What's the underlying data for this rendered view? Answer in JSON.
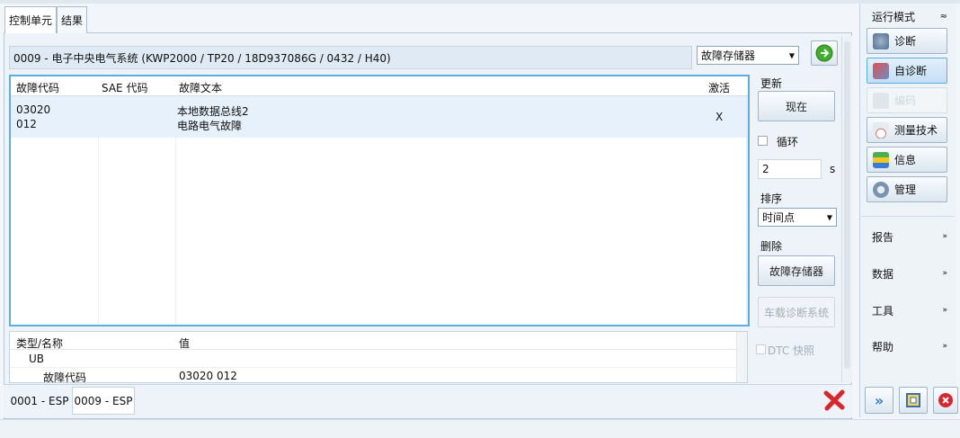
{
  "tabs": {
    "control_units": "控制单元",
    "results": "结果"
  },
  "header": {
    "ecu_title": "0009 - 电子中央电气系统  (KWP2000 / TP20 / 18D937086G / 0432 / H40)"
  },
  "memory_select": {
    "value": "故障存储器"
  },
  "fault_table": {
    "columns": {
      "code": "故障代码",
      "sae": "SAE 代码",
      "text": "故障文本",
      "active": "激活"
    },
    "rows": [
      {
        "code1": "03020",
        "code2": "012",
        "text1": "本地数据总线2",
        "text2": "电路电气故障",
        "active": "X"
      }
    ]
  },
  "details": {
    "col_type": "类型/名称",
    "col_value": "值",
    "group": "UB",
    "row_label": "故障代码",
    "row_value": "03020 012"
  },
  "controls": {
    "update_label": "更新",
    "now_button": "现在",
    "loop_label": "循环",
    "interval_value": "2",
    "interval_unit": "s",
    "sort_label": "排序",
    "sort_value": "时间点",
    "delete_label": "删除",
    "delete_memory_button": "故障存储器",
    "obd_button": "车载诊断系统",
    "dtc_snapshot_label": "DTC 快照"
  },
  "bottom_tabs": [
    "0001 - ESP",
    "0009 - ESP"
  ],
  "sidebar": {
    "run_mode": "运行模式",
    "items": [
      {
        "label": "诊断",
        "icon": "stethoscope-icon"
      },
      {
        "label": "自诊断",
        "icon": "car-diagnosis-icon"
      },
      {
        "label": "编码",
        "icon": "coding-icon"
      },
      {
        "label": "测量技术",
        "icon": "gauge-icon"
      },
      {
        "label": "信息",
        "icon": "books-icon"
      },
      {
        "label": "管理",
        "icon": "gear-icon"
      }
    ],
    "sections": [
      "报告",
      "数据",
      "工具",
      "帮助"
    ]
  },
  "colors": {
    "accent_blue": "#5aaee0",
    "row_highlight": "#e6f1fb",
    "delete_red": "#d8262e",
    "go_green": "#3fae2a"
  }
}
